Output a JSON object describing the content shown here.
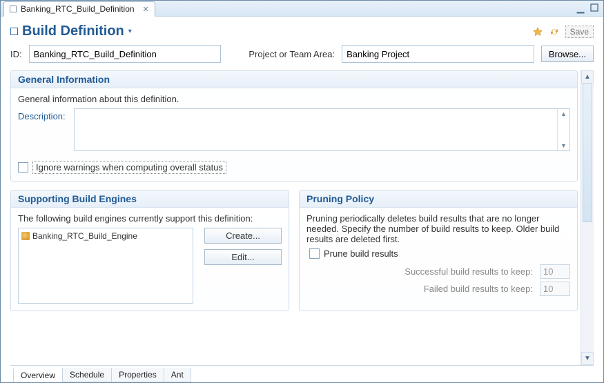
{
  "tab": {
    "title": "Banking_RTC_Build_Definition"
  },
  "header": {
    "title": "Build Definition",
    "save_label": "Save"
  },
  "fields": {
    "id_label": "ID:",
    "id_value": "Banking_RTC_Build_Definition",
    "area_label": "Project or Team Area:",
    "area_value": "Banking Project",
    "browse_label": "Browse..."
  },
  "general": {
    "title": "General Information",
    "subtitle": "General information about this definition.",
    "description_label": "Description:",
    "description_value": "",
    "ignore_label": "Ignore warnings when computing overall status"
  },
  "engines": {
    "title": "Supporting Build Engines",
    "subtitle": "The following build engines currently support this definition:",
    "items": [
      "Banking_RTC_Build_Engine"
    ],
    "create_label": "Create...",
    "edit_label": "Edit..."
  },
  "pruning": {
    "title": "Pruning Policy",
    "subtitle": "Pruning periodically deletes build results that are no longer needed. Specify the number of build results to keep. Older build results are deleted first.",
    "prune_label": "Prune build results",
    "success_label": "Successful build results to keep:",
    "success_value": "10",
    "failed_label": "Failed build results to keep:",
    "failed_value": "10"
  },
  "bottom_tabs": [
    "Overview",
    "Schedule",
    "Properties",
    "Ant"
  ]
}
